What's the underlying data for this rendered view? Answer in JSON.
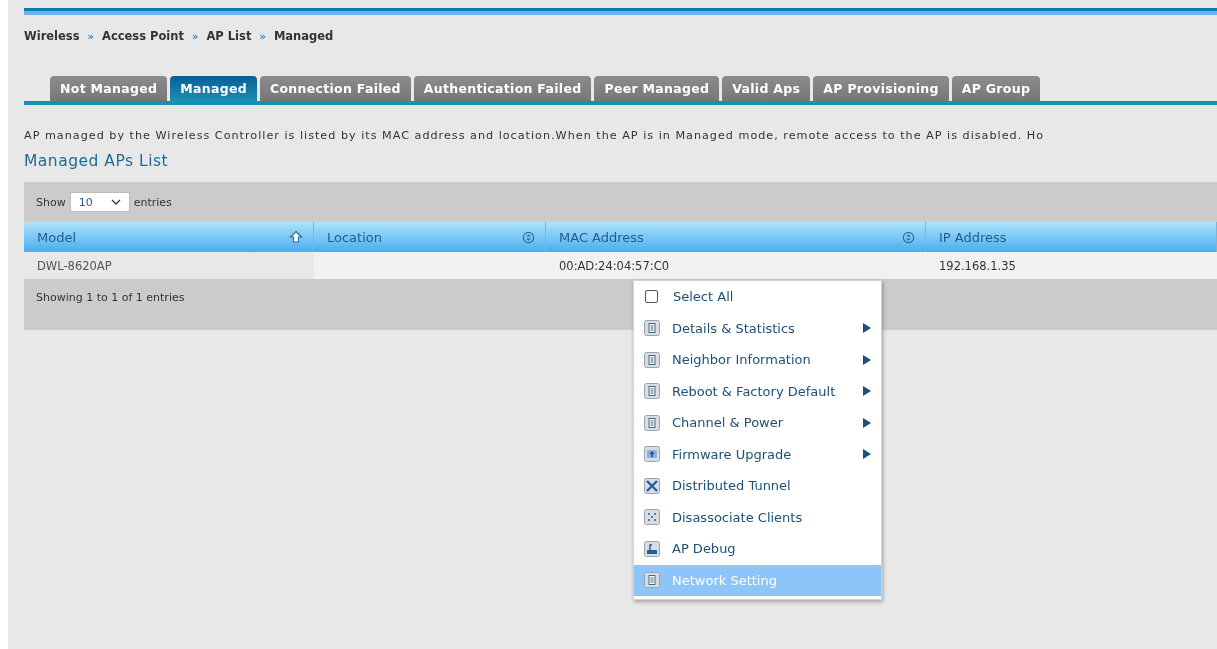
{
  "breadcrumb": [
    {
      "label": "Wireless"
    },
    {
      "label": "Access Point"
    },
    {
      "label": "AP List"
    },
    {
      "label": "Managed"
    }
  ],
  "breadcrumb_separator": "»",
  "tabs": [
    {
      "label": "Not Managed",
      "selected": false
    },
    {
      "label": "Managed",
      "selected": true
    },
    {
      "label": "Connection Failed",
      "selected": false
    },
    {
      "label": "Authentication Failed",
      "selected": false
    },
    {
      "label": "Peer Managed",
      "selected": false
    },
    {
      "label": "Valid Aps",
      "selected": false
    },
    {
      "label": "AP Provisioning",
      "selected": false
    },
    {
      "label": "AP Group",
      "selected": false
    }
  ],
  "description": "AP managed by the Wireless Controller is listed by its MAC address and location.When the AP is in Managed mode, remote access to the AP is disabled. Ho",
  "section_title": "Managed APs List",
  "length_control": {
    "prefix": "Show",
    "value": "10",
    "suffix": "entries"
  },
  "table": {
    "columns": [
      {
        "label": "Model",
        "kind": "sorted"
      },
      {
        "label": "Location",
        "kind": "sortable"
      },
      {
        "label": "MAC Address",
        "kind": "sortable"
      },
      {
        "label": "IP Address",
        "kind": "plain"
      }
    ],
    "rows": [
      [
        "DWL-8620AP",
        "",
        "00:AD:24:04:57:C0",
        "192.168.1.35"
      ]
    ],
    "info": "Showing 1 to 1 of 1 entries"
  },
  "context_menu": [
    {
      "kind": "checkbox",
      "label": "Select All",
      "checked": false,
      "selected": false
    },
    {
      "kind": "doc",
      "label": "Details & Statistics",
      "submenu": true,
      "selected": false
    },
    {
      "kind": "doc",
      "label": "Neighbor Information",
      "submenu": true,
      "selected": false
    },
    {
      "kind": "doc",
      "label": "Reboot & Factory Default",
      "submenu": true,
      "selected": false
    },
    {
      "kind": "doc",
      "label": "Channel & Power",
      "submenu": true,
      "selected": false
    },
    {
      "kind": "upload",
      "label": "Firmware Upgrade",
      "submenu": true,
      "selected": false
    },
    {
      "kind": "tunnel",
      "label": "Distributed Tunnel",
      "submenu": false,
      "selected": false
    },
    {
      "kind": "clients",
      "label": "Disassociate Clients",
      "submenu": false,
      "selected": false
    },
    {
      "kind": "debug",
      "label": "AP Debug",
      "submenu": false,
      "selected": false
    },
    {
      "kind": "doc",
      "label": "Network Setting",
      "submenu": false,
      "selected": true
    }
  ]
}
